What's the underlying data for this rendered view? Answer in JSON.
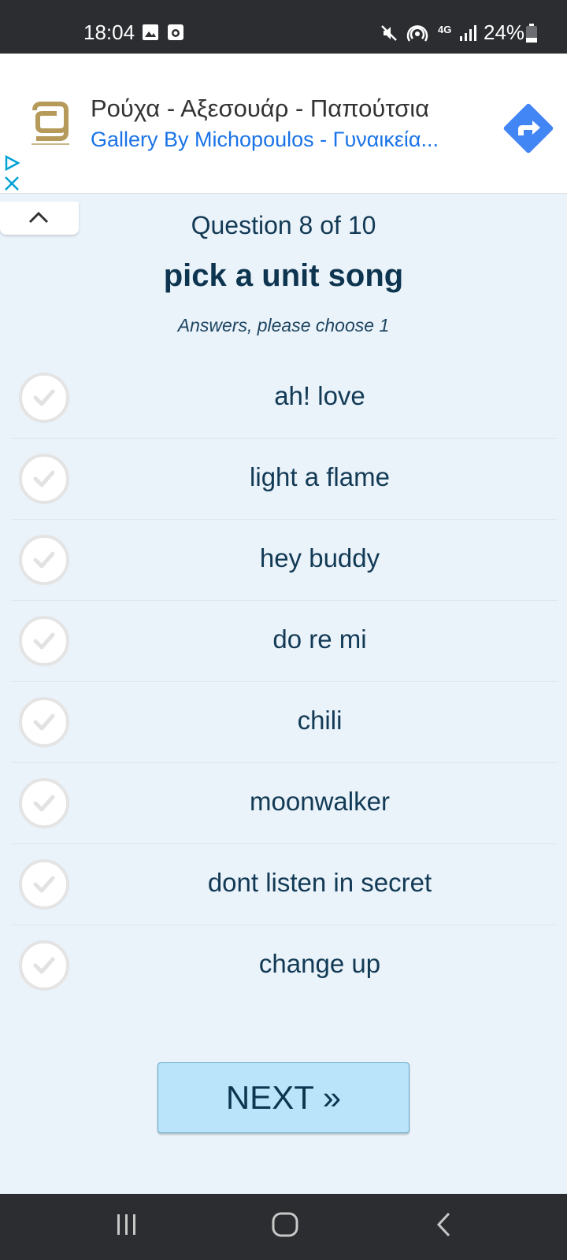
{
  "status_bar": {
    "time": "18:04",
    "battery_text": "24%",
    "network_label": "4G"
  },
  "ad": {
    "title": "Ρούχα - Αξεσουάρ - Παπούτσια",
    "subtitle": "Gallery By Michopoulos - Γυναικεία...",
    "accent_color": "#4285f4"
  },
  "quiz": {
    "counter": "Question 8 of 10",
    "title": "pick a unit song",
    "hint": "Answers, please choose 1",
    "answers": [
      {
        "label": "ah! love"
      },
      {
        "label": "light a flame"
      },
      {
        "label": "hey buddy"
      },
      {
        "label": "do re mi"
      },
      {
        "label": "chili"
      },
      {
        "label": "moonwalker"
      },
      {
        "label": "dont listen in secret"
      },
      {
        "label": "change up"
      }
    ],
    "next_label": "NEXT »"
  },
  "nav_bar": {
    "icons": [
      "recent-apps-icon",
      "home-icon",
      "back-icon"
    ]
  }
}
